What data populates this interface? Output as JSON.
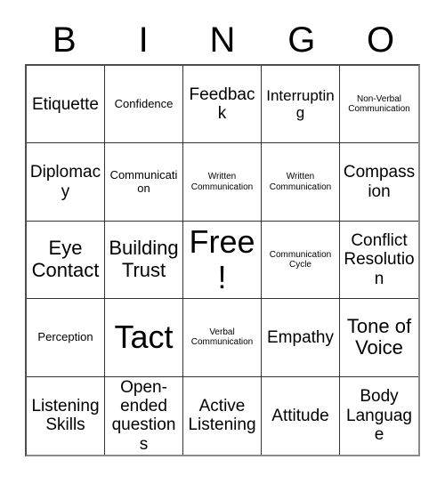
{
  "header": {
    "letters": [
      "B",
      "I",
      "N",
      "G",
      "O"
    ]
  },
  "grid": {
    "columns": 5,
    "rows": 5,
    "free_space_index": 12,
    "cells": [
      {
        "label": "Etiquette",
        "size": "lg"
      },
      {
        "label": "Confidence",
        "size": "sm"
      },
      {
        "label": "Feedback",
        "size": "lg"
      },
      {
        "label": "Interrupting",
        "size": "md"
      },
      {
        "label": "Non-Verbal Communication",
        "size": "xs"
      },
      {
        "label": "Diplomacy",
        "size": "lg"
      },
      {
        "label": "Communication",
        "size": "sm"
      },
      {
        "label": "Written Communication",
        "size": "xs"
      },
      {
        "label": "Written Communication",
        "size": "xs"
      },
      {
        "label": "Compassion",
        "size": "lg"
      },
      {
        "label": "Eye Contact",
        "size": "xl"
      },
      {
        "label": "Building Trust",
        "size": "xl"
      },
      {
        "label": "Free!",
        "size": "xxl"
      },
      {
        "label": "Communication Cycle",
        "size": "xs"
      },
      {
        "label": "Conflict Resolution",
        "size": "lg"
      },
      {
        "label": "Perception",
        "size": "sm"
      },
      {
        "label": "Tact",
        "size": "xxl"
      },
      {
        "label": "Verbal Communication",
        "size": "xs"
      },
      {
        "label": "Empathy",
        "size": "lg"
      },
      {
        "label": "Tone of Voice",
        "size": "xl"
      },
      {
        "label": "Listening Skills",
        "size": "lg"
      },
      {
        "label": "Open-ended questions",
        "size": "lg"
      },
      {
        "label": "Active Listening",
        "size": "lg"
      },
      {
        "label": "Attitude",
        "size": "lg"
      },
      {
        "label": "Body Language",
        "size": "lg"
      }
    ]
  }
}
